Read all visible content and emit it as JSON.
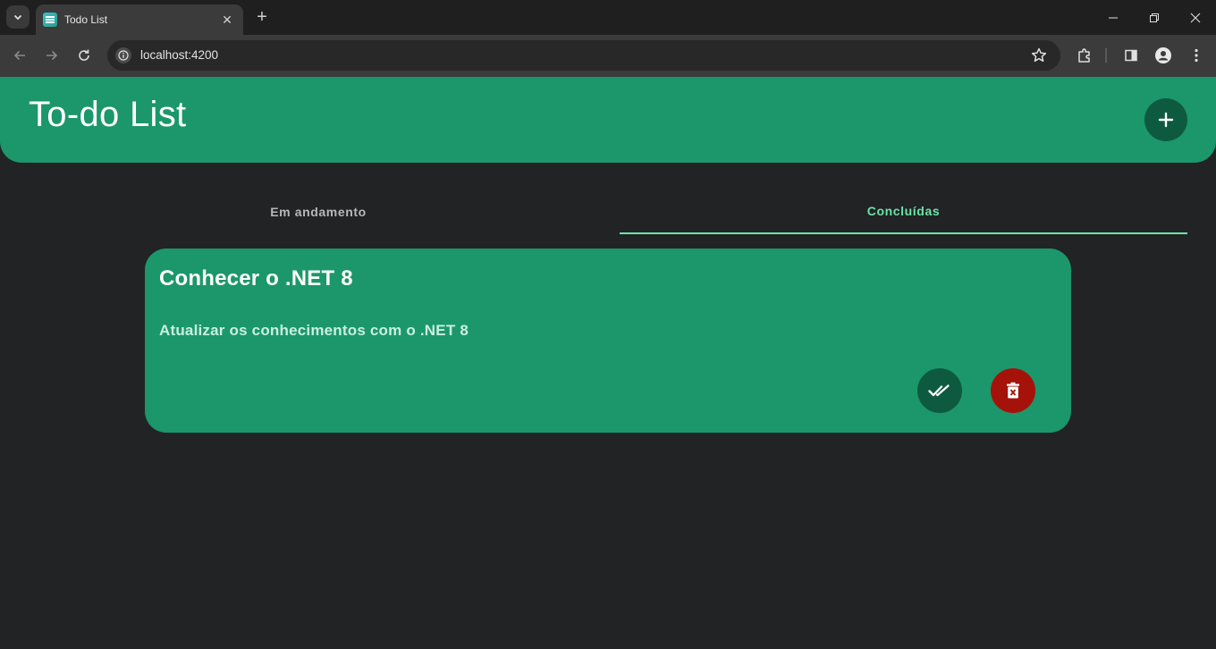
{
  "browser": {
    "tab_title": "Todo List",
    "url": "localhost:4200"
  },
  "app": {
    "title": "To-do List",
    "add_button_icon": "plus-icon"
  },
  "tabs": [
    {
      "label": "Em andamento",
      "active": false
    },
    {
      "label": "Concluídas",
      "active": true
    }
  ],
  "tasks": [
    {
      "title": "Conhecer o .NET 8",
      "description": "Atualizar os conhecimentos com o .NET 8",
      "actions": [
        "double-check-icon",
        "trash-icon"
      ]
    }
  ],
  "colors": {
    "header": "#1b976b",
    "card": "#1b976b",
    "accent": "#6be4aa",
    "fab": "#0e5a40",
    "delete": "#a51209",
    "background": "#222325"
  }
}
